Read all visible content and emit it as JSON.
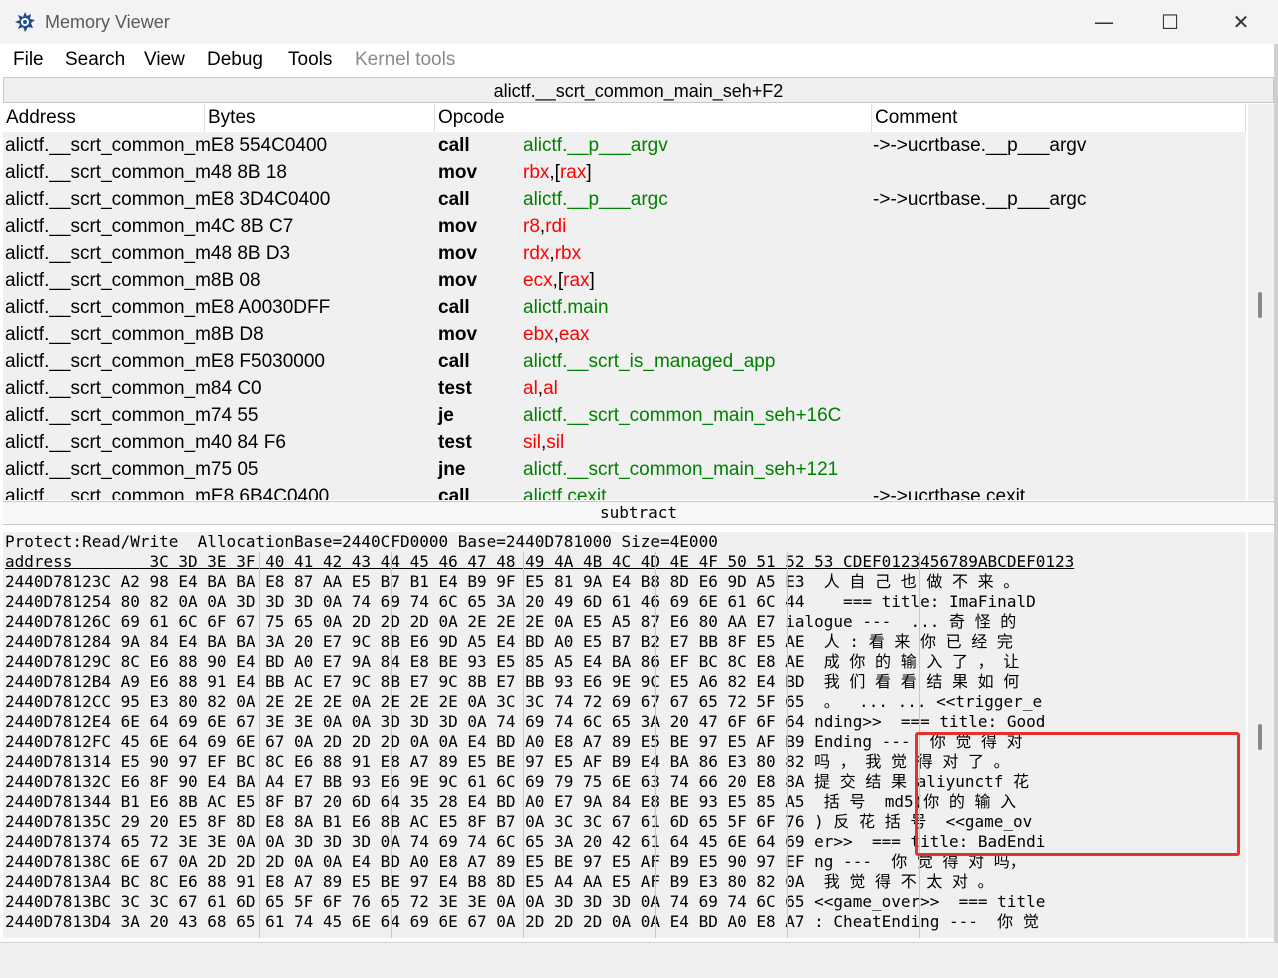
{
  "window": {
    "title": "Memory Viewer",
    "minimize_glyph": "—",
    "maximize_glyph": "☐",
    "close_glyph": "✕"
  },
  "menu": {
    "file": "File",
    "search": "Search",
    "view": "View",
    "debug": "Debug",
    "tools": "Tools",
    "kernel_tools": "Kernel tools"
  },
  "disasm": {
    "location": "alictf.__scrt_common_main_seh+F2",
    "columns": [
      "Address",
      "Bytes",
      "Opcode",
      "Comment"
    ],
    "rows": [
      {
        "addr": "alictf.__scrt_common_mE8 554C0400",
        "op": "call",
        "args": [
          {
            "t": "alictf.__p___argv",
            "c": "g"
          }
        ],
        "comment": "->->ucrtbase.__p___argv"
      },
      {
        "addr": "alictf.__scrt_common_m48 8B 18",
        "op": "mov",
        "args": [
          {
            "t": "rbx",
            "c": "r"
          },
          {
            "t": ",[",
            "c": "k"
          },
          {
            "t": "rax",
            "c": "r"
          },
          {
            "t": "]",
            "c": "k"
          }
        ],
        "comment": ""
      },
      {
        "addr": "alictf.__scrt_common_mE8 3D4C0400",
        "op": "call",
        "args": [
          {
            "t": "alictf.__p___argc",
            "c": "g"
          }
        ],
        "comment": "->->ucrtbase.__p___argc"
      },
      {
        "addr": "alictf.__scrt_common_m4C 8B C7",
        "op": "mov",
        "args": [
          {
            "t": "r8",
            "c": "r"
          },
          {
            "t": ",",
            "c": "k"
          },
          {
            "t": "rdi",
            "c": "r"
          }
        ],
        "comment": ""
      },
      {
        "addr": "alictf.__scrt_common_m48 8B D3",
        "op": "mov",
        "args": [
          {
            "t": "rdx",
            "c": "r"
          },
          {
            "t": ",",
            "c": "k"
          },
          {
            "t": "rbx",
            "c": "r"
          }
        ],
        "comment": ""
      },
      {
        "addr": "alictf.__scrt_common_m8B 08",
        "op": "mov",
        "args": [
          {
            "t": "ecx",
            "c": "r"
          },
          {
            "t": ",[",
            "c": "k"
          },
          {
            "t": "rax",
            "c": "r"
          },
          {
            "t": "]",
            "c": "k"
          }
        ],
        "comment": ""
      },
      {
        "addr": "alictf.__scrt_common_mE8 A0030DFF",
        "op": "call",
        "args": [
          {
            "t": "alictf.main",
            "c": "g"
          }
        ],
        "comment": ""
      },
      {
        "addr": "alictf.__scrt_common_m8B D8",
        "op": "mov",
        "args": [
          {
            "t": "ebx",
            "c": "r"
          },
          {
            "t": ",",
            "c": "k"
          },
          {
            "t": "eax",
            "c": "r"
          }
        ],
        "comment": ""
      },
      {
        "addr": "alictf.__scrt_common_mE8 F5030000",
        "op": "call",
        "args": [
          {
            "t": "alictf.__scrt_is_managed_app",
            "c": "g"
          }
        ],
        "comment": ""
      },
      {
        "addr": "alictf.__scrt_common_m84 C0",
        "op": "test",
        "args": [
          {
            "t": "al",
            "c": "r"
          },
          {
            "t": ",",
            "c": "k"
          },
          {
            "t": "al",
            "c": "r"
          }
        ],
        "comment": ""
      },
      {
        "addr": "alictf.__scrt_common_m74 55",
        "op": "je",
        "args": [
          {
            "t": "alictf.__scrt_common_main_seh+16C",
            "c": "g"
          }
        ],
        "comment": ""
      },
      {
        "addr": "alictf.__scrt_common_m40 84 F6",
        "op": "test",
        "args": [
          {
            "t": "sil",
            "c": "r"
          },
          {
            "t": ",",
            "c": "k"
          },
          {
            "t": "sil",
            "c": "r"
          }
        ],
        "comment": ""
      },
      {
        "addr": "alictf.__scrt_common_m75 05",
        "op": "jne",
        "args": [
          {
            "t": "alictf.__scrt_common_main_seh+121",
            "c": "g"
          }
        ],
        "comment": ""
      },
      {
        "addr": "alictf.__scrt_common_mE8 6B4C0400",
        "op": "call",
        "args": [
          {
            "t": "alictf.cexit",
            "c": "g"
          }
        ],
        "comment": "->->ucrtbase.cexit"
      }
    ]
  },
  "splitter_label": "subtract",
  "hex": {
    "protect_line": "Protect:Read/Write  AllocationBase=2440CFD0000 Base=2440D781000 Size=4E000",
    "header_line": "address        3C 3D 3E 3F 40 41 42 43 44 45 46 47 48 49 4A 4B 4C 4D 4E 4F 50 51 52 53 CDEF0123456789ABCDEF0123",
    "rows": [
      "2440D78123C A2 98 E4 BA BA E8 87 AA E5 B7 B1 E4 B9 9F E5 81 9A E4 B8 8D E6 9D A5 E3  人 自 己 也 做 不 来 。",
      "2440D781254 80 82 0A 0A 3D 3D 3D 0A 74 69 74 6C 65 3A 20 49 6D 61 46 69 6E 61 6C 44    === title: ImaFinalD",
      "2440D78126C 69 61 6C 6F 67 75 65 0A 2D 2D 2D 0A 2E 2E 2E 0A E5 A5 87 E6 80 AA E7 ialogue ---  ... 奇 怪 的",
      "2440D781284 9A 84 E4 BA BA 3A 20 E7 9C 8B E6 9D A5 E4 BD A0 E5 B7 B2 E7 BB 8F E5 AE  人 : 看 来 你 已 经 完",
      "2440D78129C 8C E6 88 90 E4 BD A0 E7 9A 84 E8 BE 93 E5 85 A5 E4 BA 86 EF BC 8C E8 AE  成 你 的 输 入 了 ， 让",
      "2440D7812B4 A9 E6 88 91 E4 BB AC E7 9C 8B E7 9C 8B E7 BB 93 E6 9E 9C E5 A6 82 E4 BD  我 们 看 看 结 果 如 何",
      "2440D7812CC 95 E3 80 82 0A 2E 2E 2E 0A 2E 2E 2E 0A 3C 3C 74 72 69 67 67 65 72 5F 65  。  ... ... <<trigger_e",
      "2440D7812E4 6E 64 69 6E 67 3E 3E 0A 0A 3D 3D 3D 0A 74 69 74 6C 65 3A 20 47 6F 6F 64 nding>>  === title: Good",
      "2440D7812FC 45 6E 64 69 6E 67 0A 2D 2D 2D 0A 0A E4 BD A0 E8 A7 89 E5 BE 97 E5 AF B9 Ending ---  你 觉 得 对",
      "2440D781314 E5 90 97 EF BC 8C E6 88 91 E8 A7 89 E5 BE 97 E5 AF B9 E4 BA 86 E3 80 82 吗 ， 我 觉 得 对 了 。",
      "2440D78132C E6 8F 90 E4 BA A4 E7 BB 93 E6 9E 9C 61 6C 69 79 75 6E 63 74 66 20 E8 8A 提 交 结 果 aliyunctf 花",
      "2440D781344 B1 E6 8B AC E5 8F B7 20 6D 64 35 28 E4 BD A0 E7 9A 84 E8 BE 93 E5 85 A5  括 号  md5(你 的 输 入",
      "2440D78135C 29 20 E5 8F 8D E8 8A B1 E6 8B AC E5 8F B7 0A 3C 3C 67 61 6D 65 5F 6F 76 ) 反 花 括 号  <<game_ov",
      "2440D781374 65 72 3E 3E 0A 0A 3D 3D 3D 0A 74 69 74 6C 65 3A 20 42 61 64 45 6E 64 69 er>>  === title: BadEndi",
      "2440D78138C 6E 67 0A 2D 2D 2D 0A 0A E4 BD A0 E8 A7 89 E5 BE 97 E5 AF B9 E5 90 97 EF ng ---  你 觉 得 对 吗，",
      "2440D7813A4 BC 8C E6 88 91 E8 A7 89 E5 BE 97 E4 B8 8D E5 A4 AA E5 AF B9 E3 80 82 0A  我 觉 得 不 太 对 。",
      "2440D7813BC 3C 3C 67 61 6D 65 5F 6F 76 65 72 3E 3E 0A 0A 3D 3D 3D 0A 74 69 74 6C 65 <<game_over>>  === title",
      "2440D7813D4 3A 20 43 68 65 61 74 45 6E 64 69 6E 67 0A 2D 2D 2D 0A 0A E4 BD A0 E8 A7 : CheatEnding ---  你 觉"
    ]
  }
}
